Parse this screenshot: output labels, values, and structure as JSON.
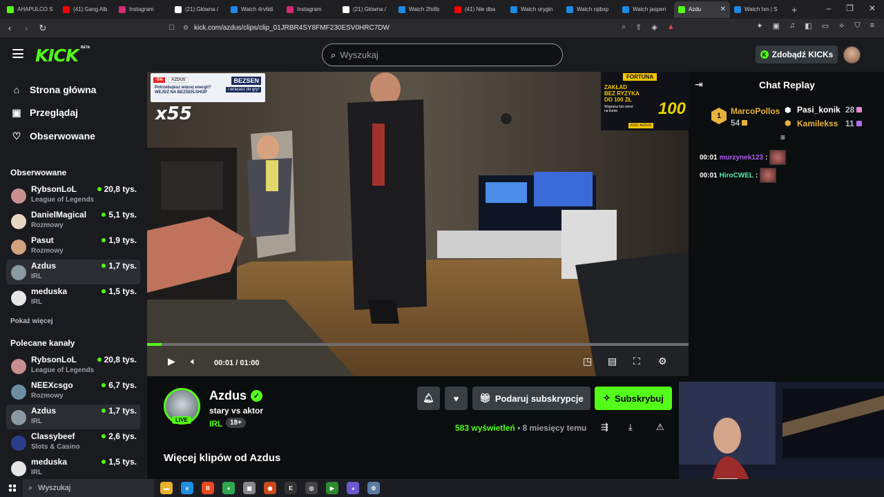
{
  "browser": {
    "tabs": [
      {
        "label": "AHAPULCO S",
        "color": "#53fc18",
        "active": false
      },
      {
        "label": "(41) Gang Alb",
        "color": "#ff0000",
        "active": false
      },
      {
        "label": "Instagram",
        "color": "#d62976",
        "active": false
      },
      {
        "label": "(21) Główna /",
        "color": "#ffffff",
        "active": false
      },
      {
        "label": "Watch 4rv6di",
        "color": "#1e88e5",
        "active": false
      },
      {
        "label": "Instagram",
        "color": "#d62976",
        "active": false
      },
      {
        "label": "(21) Główna /",
        "color": "#ffffff",
        "active": false
      },
      {
        "label": "Watch 2fs6b",
        "color": "#1e88e5",
        "active": false
      },
      {
        "label": "(41) Nie dba",
        "color": "#ff0000",
        "active": false
      },
      {
        "label": "Watch orygin",
        "color": "#1e88e5",
        "active": false
      },
      {
        "label": "Watch rqibxp",
        "color": "#1e88e5",
        "active": false
      },
      {
        "label": "Watch jaspen",
        "color": "#1e88e5",
        "active": false
      },
      {
        "label": "Azdu",
        "color": "#53fc18",
        "active": true
      },
      {
        "label": "Watch hm | S",
        "color": "#1e88e5",
        "active": false
      }
    ],
    "url": "kick.com/azdus/clips/clip_01JRBR4SY8FMF230ESV0HRC7DW"
  },
  "header": {
    "logo": "KICK",
    "beta": "BETA",
    "search_placeholder": "Wyszukaj",
    "kicks_button": "Zdobądź KICKs"
  },
  "sidebar": {
    "nav": [
      {
        "label": "Strona główna",
        "icon": "home-icon"
      },
      {
        "label": "Przeglądaj",
        "icon": "browse-icon"
      },
      {
        "label": "Obserwowane",
        "icon": "heart-icon"
      }
    ],
    "followed_heading": "Obserwowane",
    "followed": [
      {
        "name": "RybsonLoL",
        "category": "League of Legends",
        "viewers": "20,8 tys.",
        "avatar_color": "#c98f8f",
        "selected": false
      },
      {
        "name": "DanielMagical",
        "category": "Rozmowy",
        "viewers": "5,1 tys.",
        "avatar_color": "#e8d6c4",
        "selected": false
      },
      {
        "name": "Pasut",
        "category": "Rozmowy",
        "viewers": "1,9 tys.",
        "avatar_color": "#d1a27e",
        "selected": false
      },
      {
        "name": "Azdus",
        "category": "IRL",
        "viewers": "1,7 tys.",
        "avatar_color": "#8a9aa3",
        "selected": true
      },
      {
        "name": "meduska",
        "category": "IRL",
        "viewers": "1,5 tys.",
        "avatar_color": "#e6e6e6",
        "selected": false
      }
    ],
    "show_more": "Pokaż więcej",
    "recommended_heading": "Polecane kanały",
    "recommended": [
      {
        "name": "RybsonLoL",
        "category": "League of Legends",
        "viewers": "20,8 tys.",
        "avatar_color": "#c98f8f",
        "selected": false
      },
      {
        "name": "NEEXcsgo",
        "category": "Rozmowy",
        "viewers": "6,7 tys.",
        "avatar_color": "#6d8da3",
        "selected": false
      },
      {
        "name": "Azdus",
        "category": "IRL",
        "viewers": "1,7 tys.",
        "avatar_color": "#8a9aa3",
        "selected": true
      },
      {
        "name": "Classybeef",
        "category": "Slots & Casino",
        "viewers": "2,6 tys.",
        "avatar_color": "#2b3e8c",
        "selected": false
      },
      {
        "name": "meduska",
        "category": "IRL",
        "viewers": "1,5 tys.",
        "avatar_color": "#e6e6e6",
        "selected": false
      }
    ]
  },
  "video": {
    "ad_left": {
      "discount": "-5%",
      "tag": "AZDUS",
      "brand": "BEZSEN",
      "sub": "i wracasz do gry!",
      "line1": "Potrzebujesz więcej energii?",
      "line2": "WEJDŹ NA BEZSEN.SHOP"
    },
    "multiplier": "x55",
    "ad_right": {
      "brand": "FORTUNA",
      "line1": "ZAKŁAD",
      "line2": "BEZ RYZYKA",
      "line3": "DO 100 ZŁ",
      "line4": "Wygrana lub zwrot",
      "line5": "na konto",
      "code": "KOD: AZDUS",
      "big": "100"
    },
    "progress_fraction": 0.027,
    "time_current": "00:01",
    "time_sep": "/",
    "time_total": "01:00"
  },
  "channel": {
    "name": "Azdus",
    "live_badge": "LIVE",
    "clip_title": "stary vs aktor",
    "category": "IRL",
    "age_badge": "18+",
    "gift_button": "Podaruj subskrypcje",
    "subscribe_button": "Subskrybuj",
    "views": "583",
    "views_label": "wyświetleń",
    "dot": "•",
    "age": "8 miesięcy temu",
    "more_clips": "Więcej klipów od Azdus"
  },
  "chat": {
    "title": "Chat Replay",
    "leaderboard": [
      {
        "rank": "1",
        "name": "MarcoPollos",
        "count": "54",
        "color": "#e9b23a"
      },
      {
        "name": "Pasi_konik",
        "count": "28",
        "color": "#ffffff"
      },
      {
        "name": "Kamilekss",
        "count": "11",
        "color": "#e9b23a"
      }
    ],
    "messages": [
      {
        "time": "00:01",
        "user": "murzynek123",
        "sep": ":",
        "color": "#b15cf5"
      },
      {
        "time": "00:01",
        "user": "HiroCWEL",
        "sep": ":",
        "color": "#53e8a8"
      }
    ]
  },
  "taskbar": {
    "search": "Wyszukaj"
  }
}
